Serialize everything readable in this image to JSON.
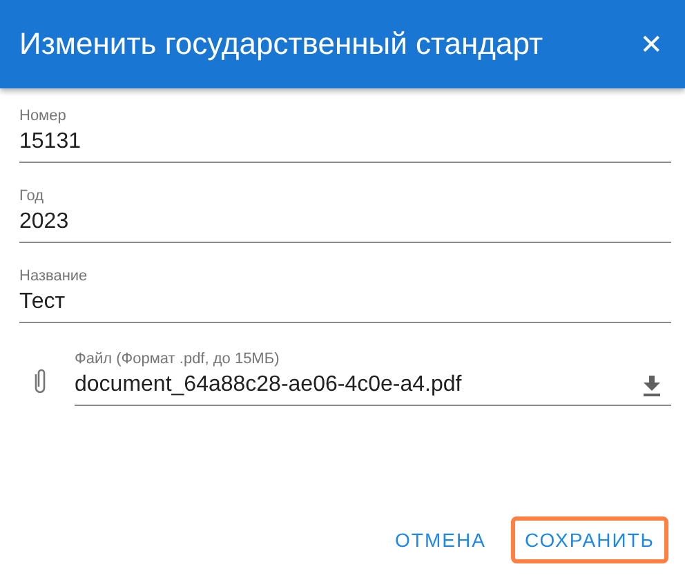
{
  "dialog": {
    "title": "Изменить государственный стандарт",
    "close": "✕"
  },
  "fields": [
    {
      "label": "Номер",
      "value": "15131"
    },
    {
      "label": "Год",
      "value": "2023"
    },
    {
      "label": "Название",
      "value": "Тест"
    }
  ],
  "file": {
    "label": "Файл (Формат .pdf, до 15МБ)",
    "value": "document_64a88c28-ae06-4c0e-a4.pdf"
  },
  "buttons": [
    {
      "label": "ОТМЕНА",
      "highlighted": false
    },
    {
      "label": "СОХРАНИТЬ",
      "highlighted": true
    }
  ]
}
